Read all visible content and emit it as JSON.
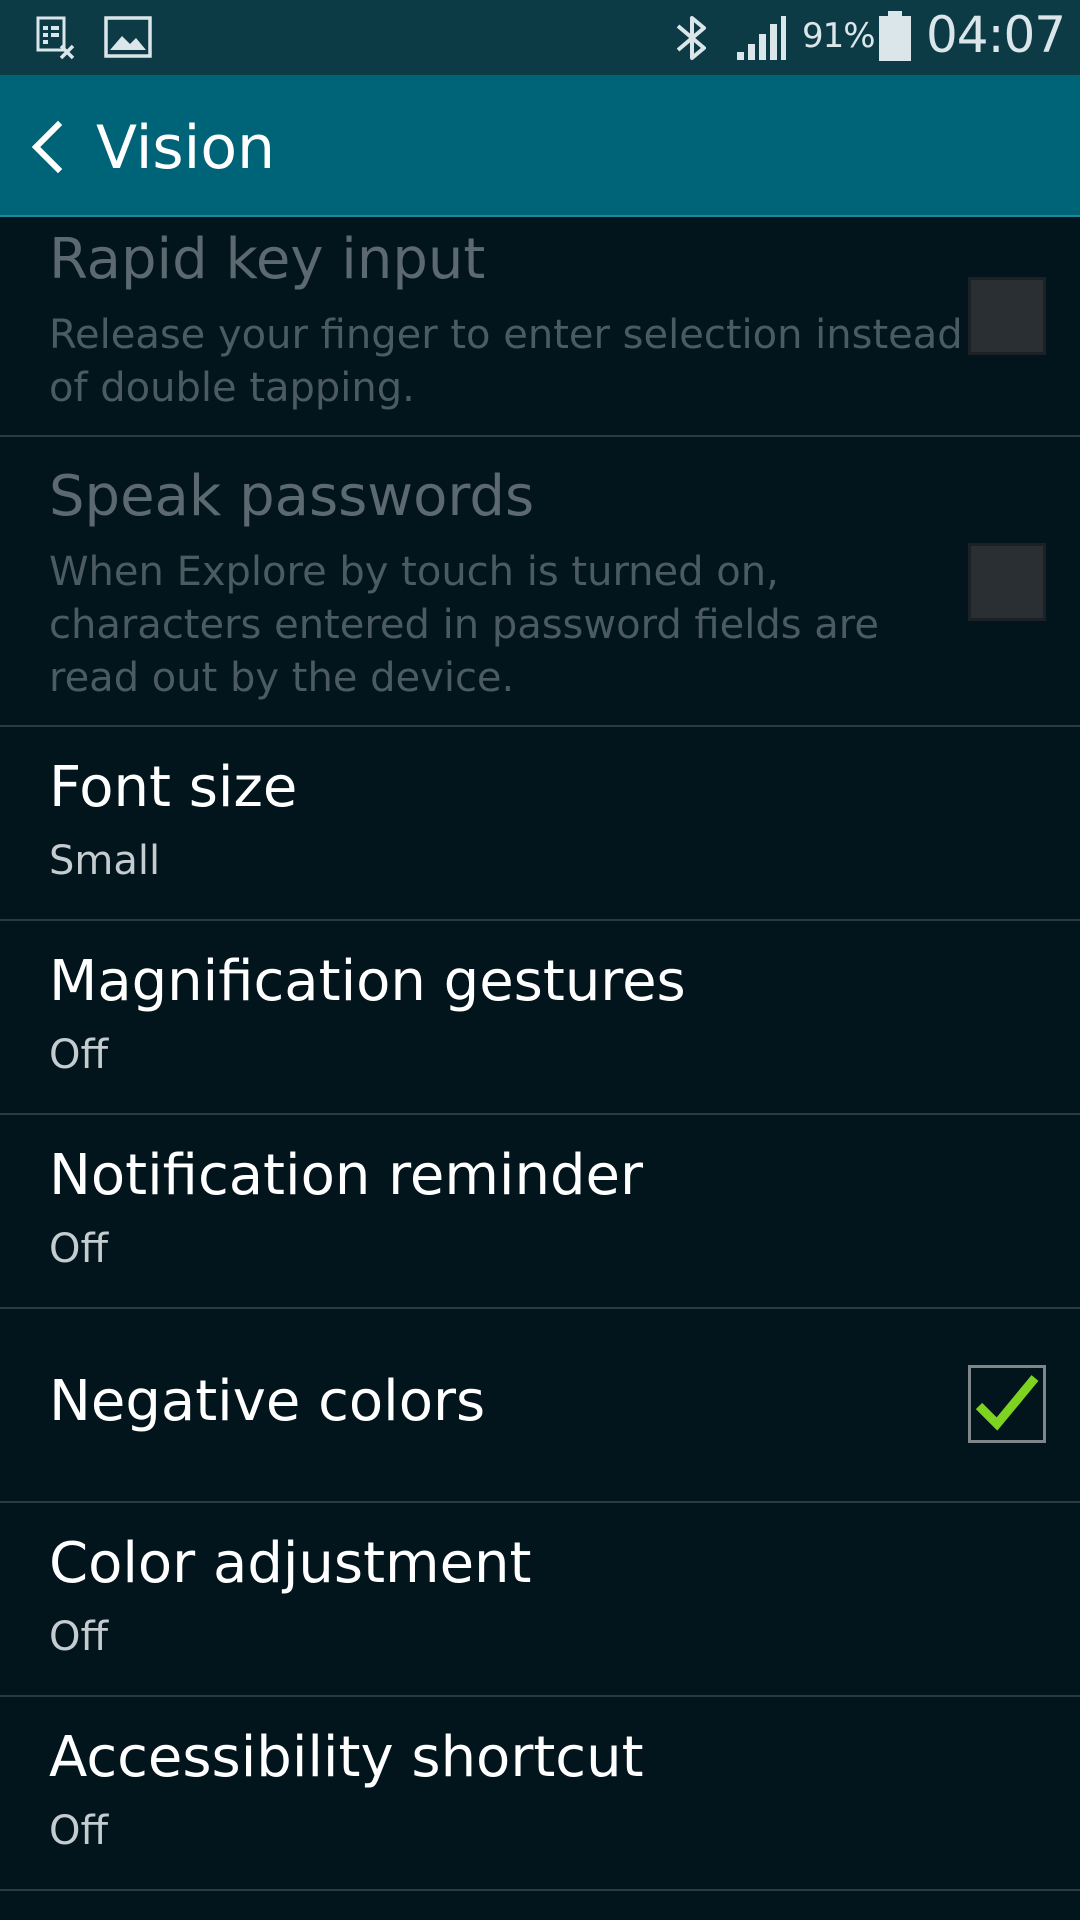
{
  "status_bar": {
    "left_icons": [
      "document-x-icon",
      "image-icon"
    ],
    "bluetooth_icon": "bluetooth-icon",
    "signal_icon": "signal-icon",
    "battery_percent": "91%",
    "battery_icon": "battery-icon",
    "time": "04:07"
  },
  "action_bar": {
    "back_icon": "chevron-left-icon",
    "title": "Vision"
  },
  "settings": [
    {
      "title": "Rapid key input",
      "summary_lines": [
        "Release your finger to enter selection instead",
        "of double tapping."
      ],
      "enabled": false,
      "checkbox": "unchecked"
    },
    {
      "title": "Speak passwords",
      "summary_lines": [
        "When Explore by touch is turned on,",
        "characters entered in password fields are",
        "read out by the device."
      ],
      "enabled": false,
      "checkbox": "unchecked"
    },
    {
      "title": "Font size",
      "summary": "Small"
    },
    {
      "title": "Magnification gestures",
      "summary": "Off"
    },
    {
      "title": "Notification reminder",
      "summary": "Off"
    },
    {
      "title": "Negative colors",
      "checkbox": "checked"
    },
    {
      "title": "Color adjustment",
      "summary": "Off"
    },
    {
      "title": "Accessibility shortcut",
      "summary": "Off"
    }
  ],
  "colors": {
    "status_bar": "#0d3b45",
    "action_bar": "#006478",
    "background": "#02141c",
    "check_mark": "#7ed321"
  }
}
